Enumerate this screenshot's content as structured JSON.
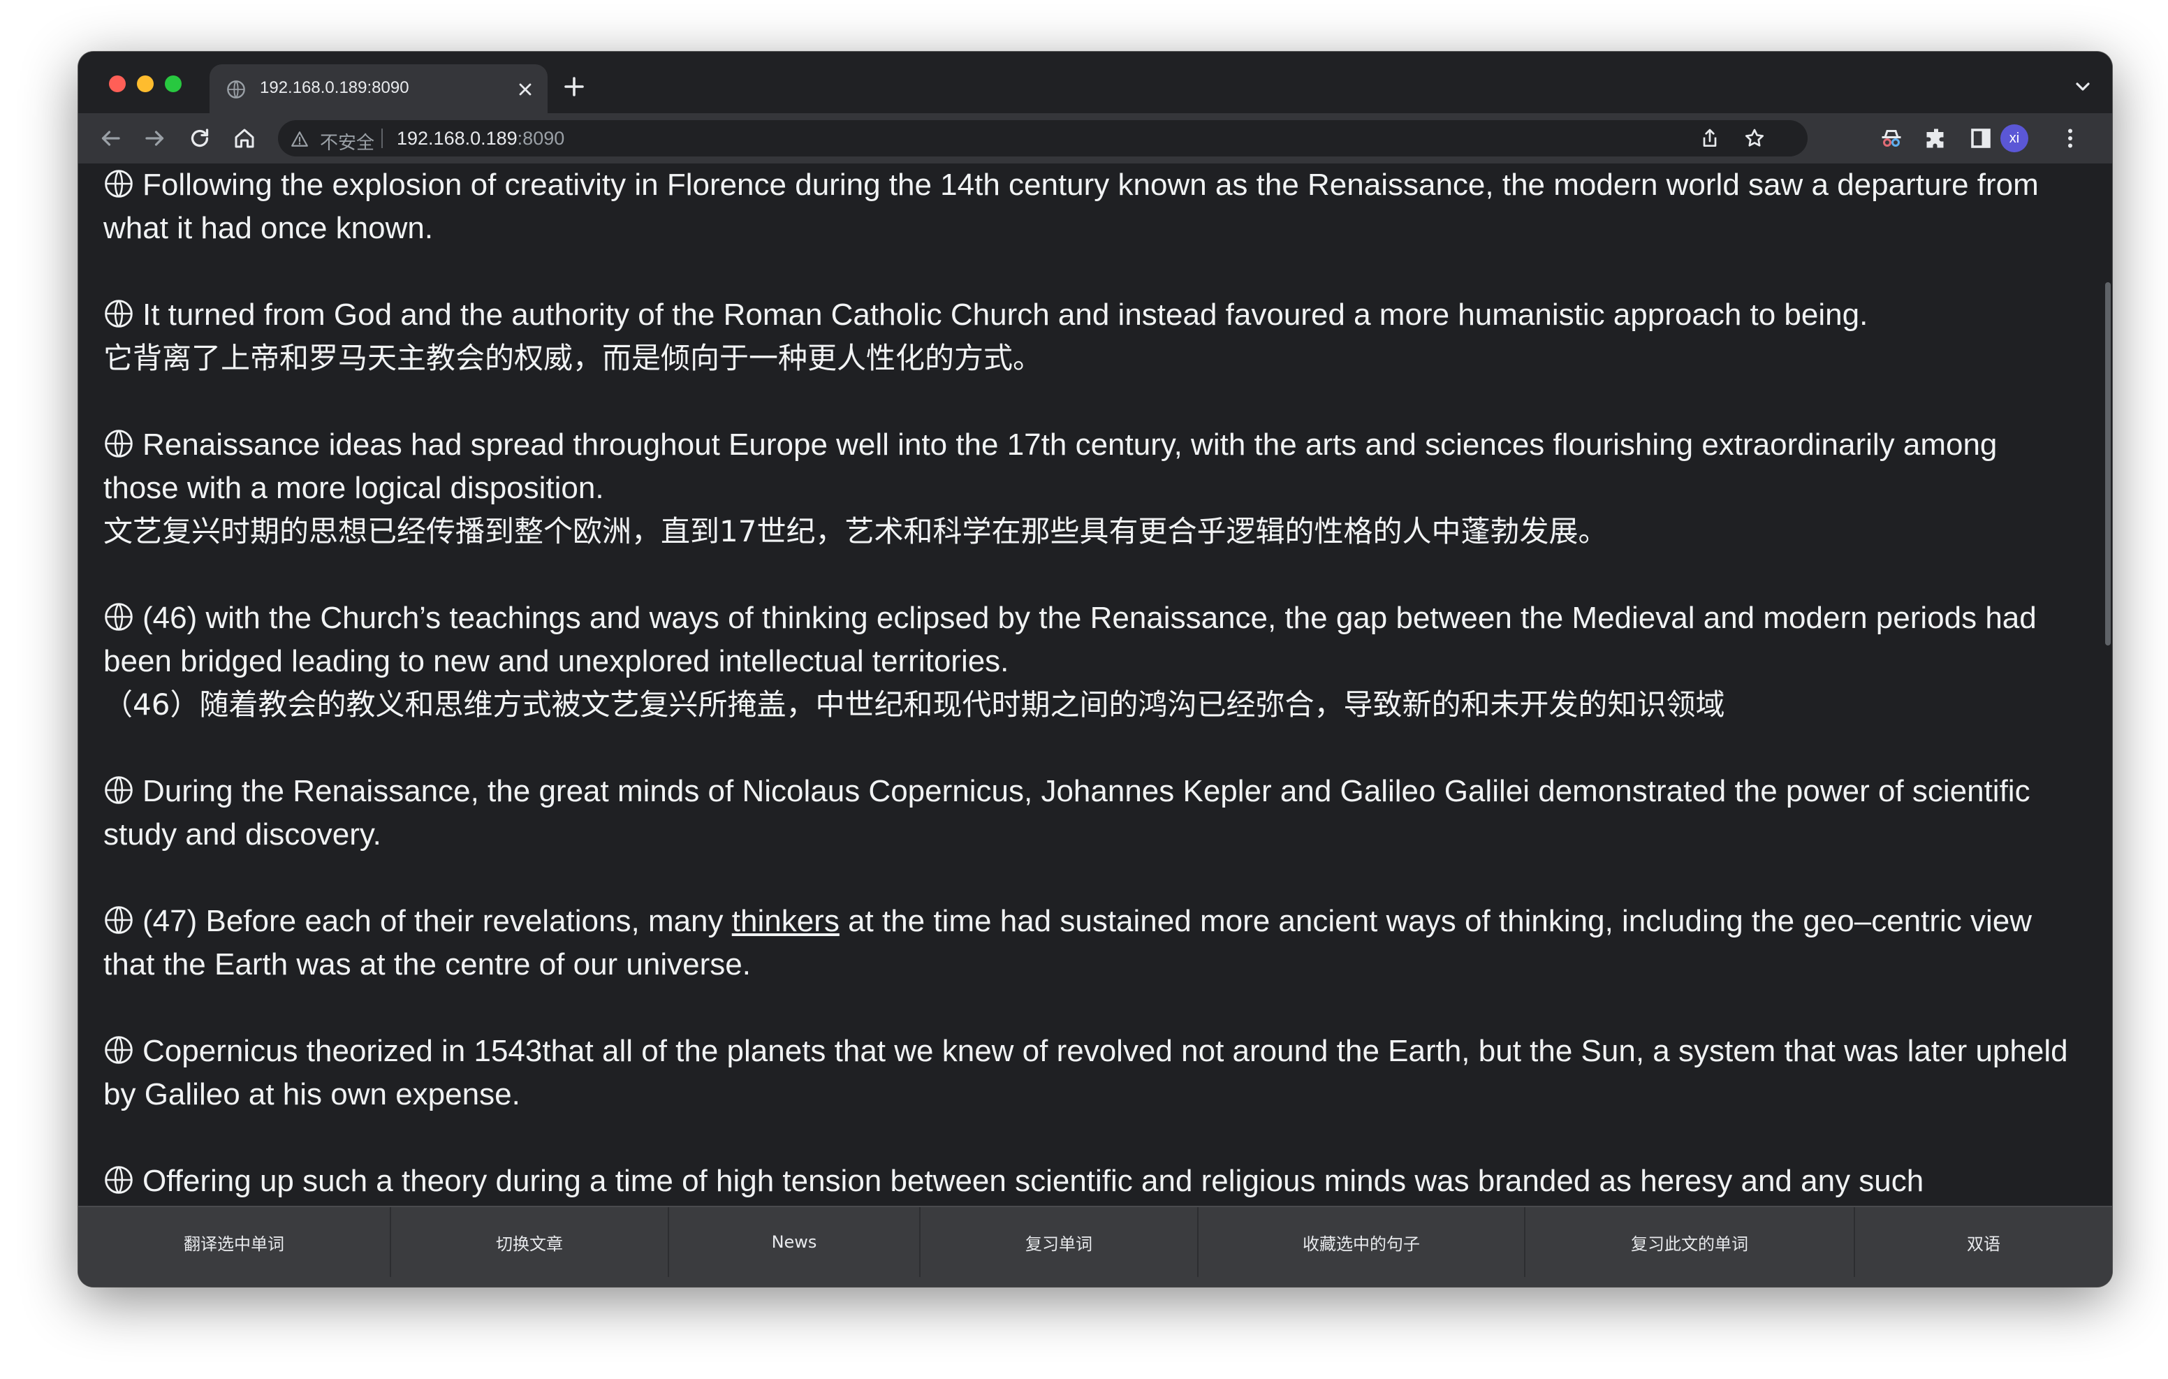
{
  "browser": {
    "tab_title": "192.168.0.189:8090",
    "insecure_label": "不安全",
    "url_host": "192.168.0.189",
    "url_port": ":8090",
    "profile_initials": "xi"
  },
  "article": {
    "paragraphs": [
      {
        "en": "Following the explosion of creativity in Florence during the 14th century known as the Renaissance, the modern world saw a departure from what it had once known.",
        "zh": ""
      },
      {
        "en": "It turned from God and the authority of the Roman Catholic Church and instead favoured a more humanistic approach to being.",
        "zh": "它背离了上帝和罗马天主教会的权威，而是倾向于一种更人性化的方式。"
      },
      {
        "en": "Renaissance ideas had spread throughout Europe well into the 17th century, with the arts and sciences flourishing extraordinarily among those with a more logical disposition.",
        "zh": "文艺复兴时期的思想已经传播到整个欧洲，直到17世纪，艺术和科学在那些具有更合乎逻辑的性格的人中蓬勃发展。"
      },
      {
        "en": "(46) with the Church’s teachings and ways of thinking eclipsed by the Renaissance, the gap between the Medieval and modern periods had been bridged leading to new and unexplored intellectual territories.",
        "zh": "（46）随着教会的教义和思维方式被文艺复兴所掩盖，中世纪和现代时期之间的鸿沟已经弥合，导致新的和未开发的知识领域"
      },
      {
        "en": "During the Renaissance, the great minds of Nicolaus Copernicus, Johannes Kepler and Galileo Galilei demonstrated the power of scientific study and discovery.",
        "zh": ""
      },
      {
        "en_before": "(47) Before each of their revelations, many ",
        "en_link": "thinkers",
        "en_after": " at the time had sustained more ancient ways of thinking, including the geo–centric view that the Earth was at the centre of our universe.",
        "zh": ""
      },
      {
        "en": "Copernicus theorized in 1543that all of the planets that we knew of revolved not around the Earth, but the Sun, a system that was later upheld by Galileo at his own expense.",
        "zh": ""
      },
      {
        "en": "Offering up such a theory during a time of high tension between scientific and religious minds was branded as heresy and any such",
        "zh": ""
      }
    ]
  },
  "bottom_bar": {
    "items": [
      "翻译选中单词",
      "切换文章",
      "News",
      "复习单词",
      "收藏选中的句子",
      "复习此文的单词",
      "双语"
    ]
  }
}
